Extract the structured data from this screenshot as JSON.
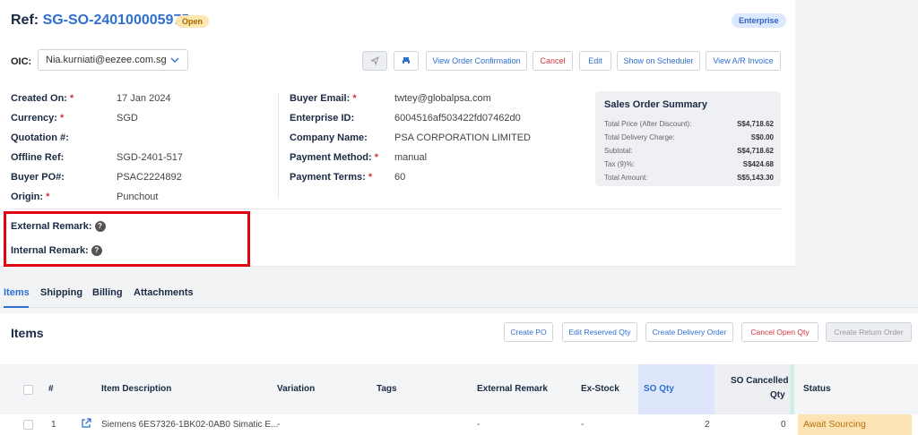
{
  "header": {
    "ref_prefix": "Ref: ",
    "ref_number": "SG-SO-240100005975",
    "status_badge": "Open",
    "enterprise_badge": "Enterprise"
  },
  "oic": {
    "label": "OIC:",
    "value": "Nia.kurniati@eezee.com.sg"
  },
  "toolbar": {
    "send_icon": "send-icon",
    "print_icon": "print-icon",
    "view_order_confirmation": "View Order Confirmation",
    "cancel": "Cancel",
    "edit": "Edit",
    "show_on_scheduler": "Show on Scheduler",
    "view_ar_invoice": "View A/R Invoice"
  },
  "details_left": [
    {
      "label": "Created On:",
      "required": true,
      "value": "17 Jan 2024"
    },
    {
      "label": "Currency:",
      "required": true,
      "value": "SGD"
    },
    {
      "label": "Quotation #:",
      "required": false,
      "value": ""
    },
    {
      "label": "Offline Ref:",
      "required": false,
      "value": "SGD-2401-517"
    },
    {
      "label": "Buyer PO#:",
      "required": false,
      "value": "PSAC2224892"
    },
    {
      "label": "Origin:",
      "required": true,
      "value": "Punchout"
    }
  ],
  "details_mid": [
    {
      "label": "Buyer Email:",
      "required": true,
      "value": "twtey@globalpsa.com"
    },
    {
      "label": "Enterprise ID:",
      "required": false,
      "value": "6004516af503422fd07462d0"
    },
    {
      "label": "Company Name:",
      "required": false,
      "value": "PSA CORPORATION LIMITED"
    },
    {
      "label": "Payment Method:",
      "required": true,
      "value": "manual"
    },
    {
      "label": "Payment Terms:",
      "required": true,
      "value": "60"
    }
  ],
  "summary": {
    "title": "Sales Order Summary",
    "rows": [
      {
        "label": "Total Price (After Discount):",
        "value": "S$4,718.62"
      },
      {
        "label": "Total Delivery Charge:",
        "value": "S$0.00"
      },
      {
        "label": "Subtotal:",
        "value": "S$4,718.62"
      },
      {
        "label": "Tax (9)%:",
        "value": "S$424.68"
      },
      {
        "label": "Total Amount:",
        "value": "S$5,143.30"
      }
    ]
  },
  "remarks": {
    "external_label": "External Remark:",
    "external_value": "-",
    "internal_label": "Internal Remark:",
    "internal_value": "-",
    "highlight_color": "#e3000f"
  },
  "tabs": [
    {
      "label": "Items",
      "active": true
    },
    {
      "label": "Shipping",
      "active": false
    },
    {
      "label": "Billing",
      "active": false
    },
    {
      "label": "Attachments",
      "active": false
    }
  ],
  "items": {
    "title": "Items",
    "buttons": {
      "create_po": "Create PO",
      "edit_reserved_qty": "Edit Reserved Qty",
      "create_delivery_order": "Create Delivery Order",
      "cancel_open_qty": "Cancel Open Qty",
      "create_return_order": "Create Return Order"
    },
    "columns": [
      "#",
      "Item Description",
      "Variation",
      "Tags",
      "External Remark",
      "Ex-Stock",
      "SO Qty",
      "SO Cancelled",
      "Qty",
      "Status"
    ],
    "rows": [
      {
        "num": "1",
        "description": "Siemens 6ES7326-1BK02-0AB0 Simatic E...",
        "variation": "-",
        "tags": "",
        "external_remark": "-",
        "ex_stock": "-",
        "so_qty": "2",
        "so_cancelled_qty": "0",
        "status": "Await Sourcing"
      }
    ]
  }
}
